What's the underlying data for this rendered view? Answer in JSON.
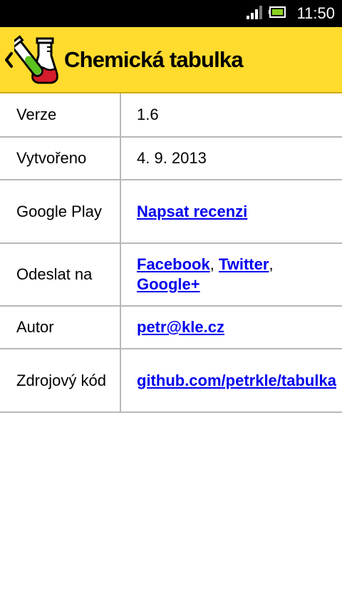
{
  "status_bar": {
    "time": "11:50",
    "signal_icon": "signal-strength-icon",
    "battery_icon": "battery-icon"
  },
  "action_bar": {
    "title": "Chemická tabulka",
    "up_icon": "chevron-left-icon",
    "logo_icon": "chemistry-flask-icon",
    "background_color": "#fedb2d"
  },
  "about": {
    "rows": [
      {
        "label": "Verze",
        "value": "1.6"
      },
      {
        "label": "Vytvořeno",
        "value": "4. 9. 2013"
      },
      {
        "label": "Google Play",
        "link": "Napsat recenzi"
      },
      {
        "label": "Odeslat na",
        "links": [
          "Facebook",
          "Twitter",
          "Google+"
        ],
        "separator": ","
      },
      {
        "label": "Autor",
        "link": "petr@kle.cz"
      },
      {
        "label": "Zdrojový kód",
        "link": "github.com/petrkle/tabulka"
      }
    ]
  },
  "colors": {
    "link": "#0000ee",
    "divider": "#b8b8b8"
  }
}
